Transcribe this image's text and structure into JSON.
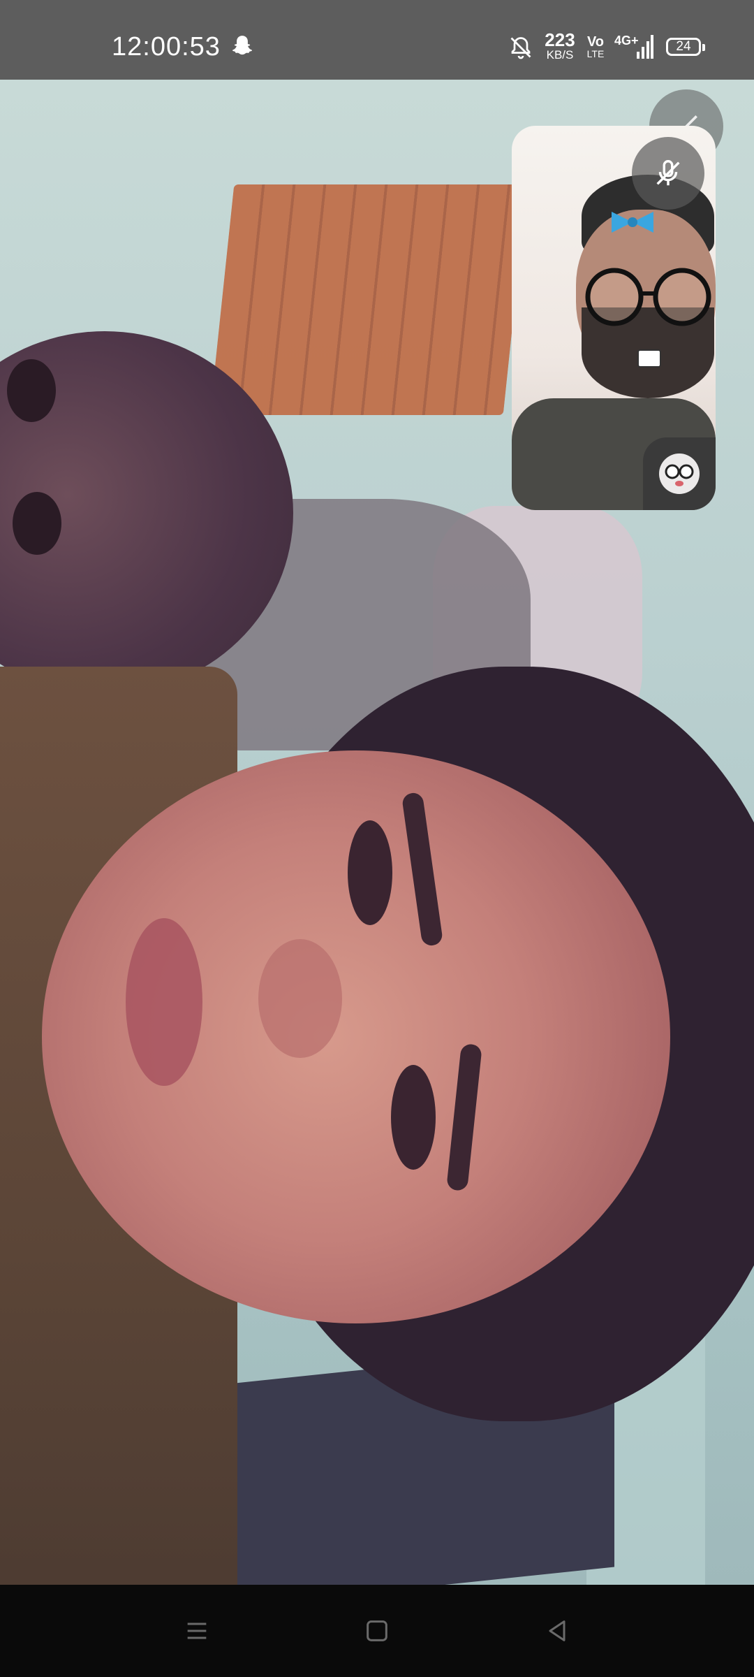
{
  "status_bar": {
    "time": "12:00:53",
    "speed_value": "223",
    "speed_unit": "KB/S",
    "volte_top": "Vo",
    "volte_bottom": "LTE",
    "network": "4G+",
    "battery": "24",
    "icons": [
      "snapchat-ghost-icon",
      "bell-muted-icon",
      "signal-icon"
    ]
  },
  "call": {
    "local_preview_muted": true,
    "lens_icon": "glasses-lens-icon"
  },
  "nav_bar": {
    "icons": [
      "menu-icon",
      "home-icon",
      "back-icon"
    ]
  }
}
